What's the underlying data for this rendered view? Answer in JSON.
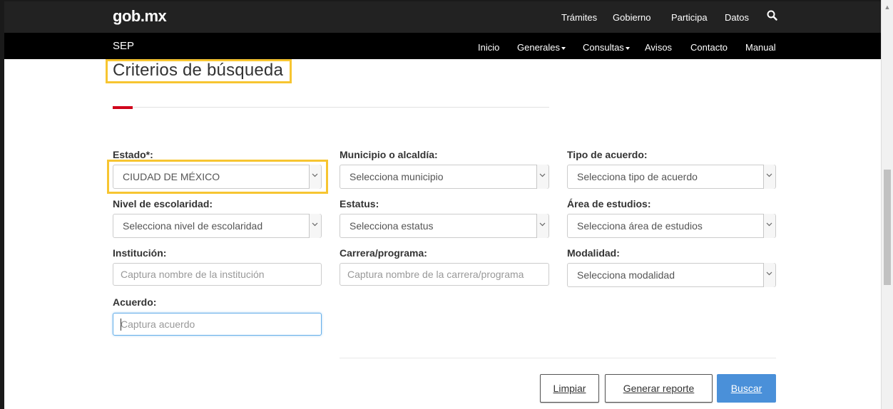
{
  "header": {
    "logo": "gob.mx",
    "logo_main": "gob",
    "logo_dot": ".",
    "logo_end": "mx",
    "nav": [
      "Trámites",
      "Gobierno",
      "Participa",
      "Datos"
    ]
  },
  "subheader": {
    "title": "SEP",
    "nav": {
      "inicio": "Inicio",
      "generales": "Generales",
      "consultas": "Consultas",
      "avisos": "Avisos",
      "contacto": "Contacto",
      "manual": "Manual"
    }
  },
  "page": {
    "heading": "Criterios de búsqueda"
  },
  "form": {
    "estado": {
      "label": "Estado*:",
      "value": "CIUDAD DE MÉXICO"
    },
    "municipio": {
      "label": "Municipio o alcaldía:",
      "value": "Selecciona municipio"
    },
    "tipo_acuerdo": {
      "label": "Tipo de acuerdo:",
      "value": "Selecciona tipo de acuerdo"
    },
    "nivel": {
      "label": "Nivel de escolaridad:",
      "value": "Selecciona nivel de escolaridad"
    },
    "estatus": {
      "label": "Estatus:",
      "value": "Selecciona estatus"
    },
    "area": {
      "label": "Área de estudios:",
      "value": "Selecciona área de estudios"
    },
    "institucion": {
      "label": "Institución:",
      "placeholder": "Captura nombre de la institución"
    },
    "carrera": {
      "label": "Carrera/programa:",
      "placeholder": "Captura nombre de la carrera/programa"
    },
    "modalidad": {
      "label": "Modalidad:",
      "value": "Selecciona modalidad"
    },
    "acuerdo": {
      "label": "Acuerdo:",
      "placeholder": "Captura acuerdo"
    }
  },
  "buttons": {
    "limpiar": "Limpiar",
    "generar": "Generar reporte",
    "buscar": "Buscar"
  },
  "colors": {
    "highlight": "#f7c531",
    "accent_red": "#d0021b",
    "primary_button": "#4a90d9"
  }
}
